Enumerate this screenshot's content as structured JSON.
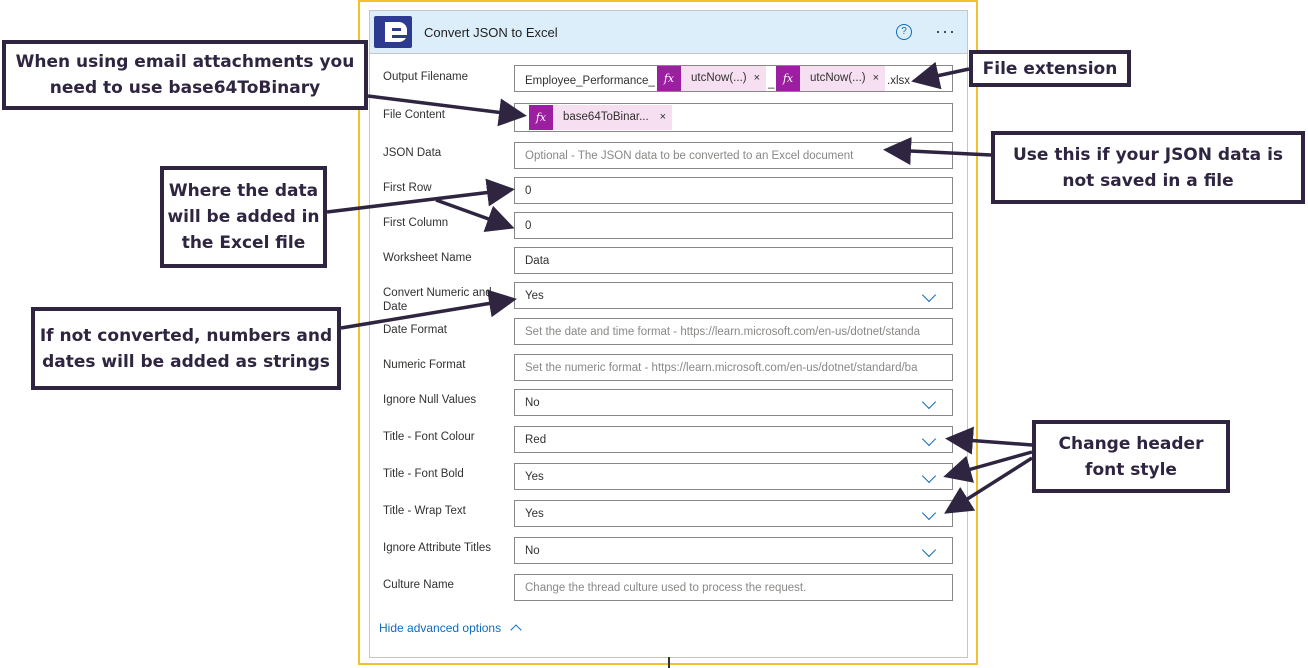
{
  "card": {
    "title": "Convert JSON to Excel",
    "help_icon": "?",
    "more_icon": "···"
  },
  "fields": {
    "output_filename": {
      "label": "Output Filename",
      "prefix": "Employee_Performance_",
      "token1": "utcNow(...)",
      "separator": "_",
      "token2": "utcNow(...)",
      "suffix": ".xlsx"
    },
    "file_content": {
      "label": "File Content",
      "token": "base64ToBinar..."
    },
    "json_data": {
      "label": "JSON Data",
      "placeholder": "Optional - The JSON data to be converted to an Excel document"
    },
    "first_row": {
      "label": "First Row",
      "value": "0"
    },
    "first_column": {
      "label": "First Column",
      "value": "0"
    },
    "worksheet_name": {
      "label": "Worksheet Name",
      "value": "Data"
    },
    "convert_numeric": {
      "label": "Convert Numeric and Date",
      "value": "Yes"
    },
    "date_format": {
      "label": "Date Format",
      "placeholder": "Set the date and time format - https://learn.microsoft.com/en-us/dotnet/standa"
    },
    "numeric_format": {
      "label": "Numeric Format",
      "placeholder": "Set the numeric format - https://learn.microsoft.com/en-us/dotnet/standard/ba"
    },
    "ignore_null": {
      "label": "Ignore Null Values",
      "value": "No"
    },
    "title_font_colour": {
      "label": "Title - Font Colour",
      "value": "Red"
    },
    "title_font_bold": {
      "label": "Title - Font Bold",
      "value": "Yes"
    },
    "title_wrap_text": {
      "label": "Title - Wrap Text",
      "value": "Yes"
    },
    "ignore_attr_titles": {
      "label": "Ignore Attribute Titles",
      "value": "No"
    },
    "culture_name": {
      "label": "Culture Name",
      "placeholder": "Change the thread culture used to process the request."
    }
  },
  "hide_advanced": "Hide advanced options",
  "fx_symbol": "fx",
  "close_symbol": "×",
  "callouts": {
    "email": "When using email attachments you need to use base64ToBinary",
    "extension": "File extension",
    "json": "Use this if your JSON data is not saved in a file",
    "where": "Where the data will be added in the Excel file",
    "converted": "If not converted, numbers and dates will be added as strings",
    "header": "Change header font style"
  },
  "colors": {
    "accent": "#0f6cbd",
    "frame": "#f2c12e",
    "callout": "#2f2541",
    "token_bg": "#f6dff1",
    "fx_bg": "#9b1fa0",
    "header_bg": "#ddeefb"
  }
}
